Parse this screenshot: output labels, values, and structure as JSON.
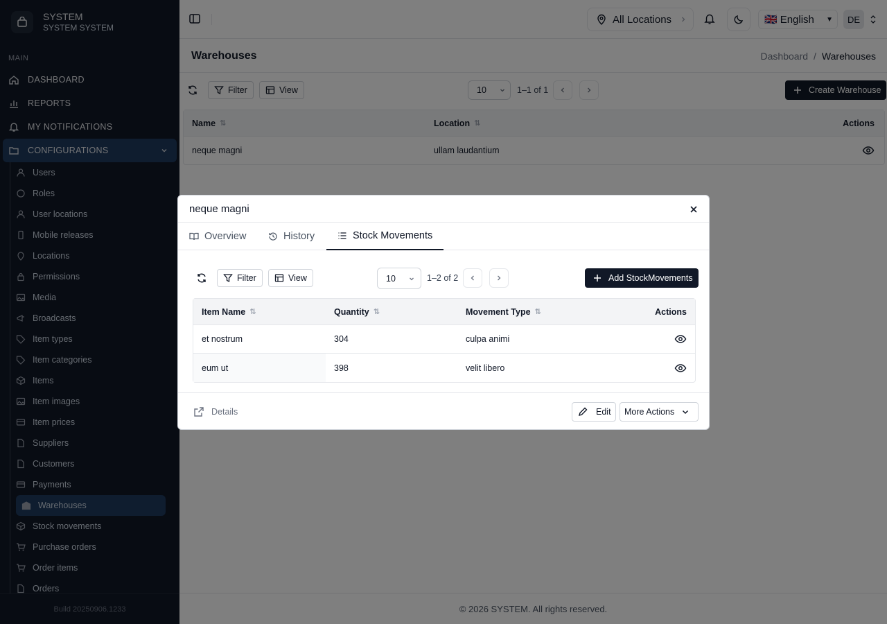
{
  "brand": {
    "title": "SYSTEM",
    "subtitle": "SYSTEM SYSTEM"
  },
  "sidebar": {
    "section_label": "MAIN",
    "items": [
      {
        "label": "DASHBOARD",
        "icon": "home-icon"
      },
      {
        "label": "REPORTS",
        "icon": "chart-icon"
      },
      {
        "label": "MY NOTIFICATIONS",
        "icon": "bell-icon"
      },
      {
        "label": "CONFIGURATIONS",
        "icon": "folder-icon"
      }
    ],
    "sub_items": [
      {
        "label": "Users"
      },
      {
        "label": "Roles"
      },
      {
        "label": "User locations"
      },
      {
        "label": "Mobile releases"
      },
      {
        "label": "Locations"
      },
      {
        "label": "Permissions"
      },
      {
        "label": "Media"
      },
      {
        "label": "Broadcasts"
      },
      {
        "label": "Item types"
      },
      {
        "label": "Item categories"
      },
      {
        "label": "Items"
      },
      {
        "label": "Item images"
      },
      {
        "label": "Item prices"
      },
      {
        "label": "Suppliers"
      },
      {
        "label": "Customers"
      },
      {
        "label": "Payments"
      },
      {
        "label": "Warehouses"
      },
      {
        "label": "Stock movements"
      },
      {
        "label": "Purchase orders"
      },
      {
        "label": "Order items"
      },
      {
        "label": "Orders"
      }
    ],
    "build": "Build 20250906.1233"
  },
  "topbar": {
    "location": "All Locations",
    "language": "English",
    "flag": "🇬🇧",
    "avatar": "DE"
  },
  "page": {
    "title": "Warehouses",
    "breadcrumb": [
      "Dashboard",
      "/",
      "Warehouses"
    ]
  },
  "toolbar": {
    "filter": "Filter",
    "view": "View",
    "page_size": "10",
    "range": "1–1 of 1",
    "create": "Create Warehouse"
  },
  "table": {
    "columns": [
      "Name",
      "Location",
      "Actions"
    ],
    "rows": [
      {
        "name": "neque magni",
        "location": "ullam laudantium"
      }
    ]
  },
  "modal": {
    "title": "neque magni",
    "tabs": [
      "Overview",
      "History",
      "Stock Movements"
    ],
    "toolbar": {
      "filter": "Filter",
      "view": "View",
      "page_size": "10",
      "range": "1–2 of 2",
      "add": "Add StockMovements"
    },
    "table": {
      "columns": [
        "Item Name",
        "Quantity",
        "Movement Type",
        "Actions"
      ],
      "rows": [
        {
          "item": "et nostrum",
          "qty": "304",
          "type": "culpa animi"
        },
        {
          "item": "eum ut",
          "qty": "398",
          "type": "velit libero"
        }
      ]
    },
    "footer": {
      "details": "Details",
      "edit": "Edit",
      "more": "More Actions"
    }
  },
  "footer": {
    "copyright": "© 2026 SYSTEM. All rights reserved."
  },
  "colors": {
    "sidebar_bg": "#111827",
    "active_bg": "#1e3a5f",
    "primary": "#111827"
  }
}
